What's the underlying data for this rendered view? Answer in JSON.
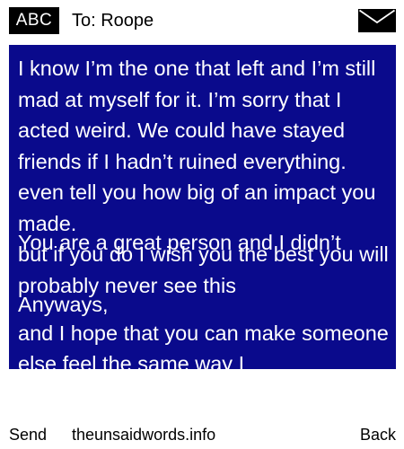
{
  "header": {
    "mode_label": "ABC",
    "recipient_text": "To: Roope",
    "icon": "envelope-icon"
  },
  "message": {
    "text_layer_1": "I know I’m the one that left and I’m still mad at myself for it. I’m sorry that I acted weird. We could have stayed friends if I hadn’t ruined everything.\neven tell you how big of an impact you made.\nbut if you do I wish you the best you will probably never see this",
    "text_layer_2": "You are a great person and I didn’t\n\nAnyways,",
    "text_layer_3": "\n\n\nand I hope that you can make someone else feel the same way I"
  },
  "footer": {
    "send_label": "Send",
    "site_label": "theunsaidwords.info",
    "back_label": "Back"
  },
  "colors": {
    "message_background": "#0a0a8c",
    "message_text": "#ffffff",
    "badge_background": "#000000"
  }
}
